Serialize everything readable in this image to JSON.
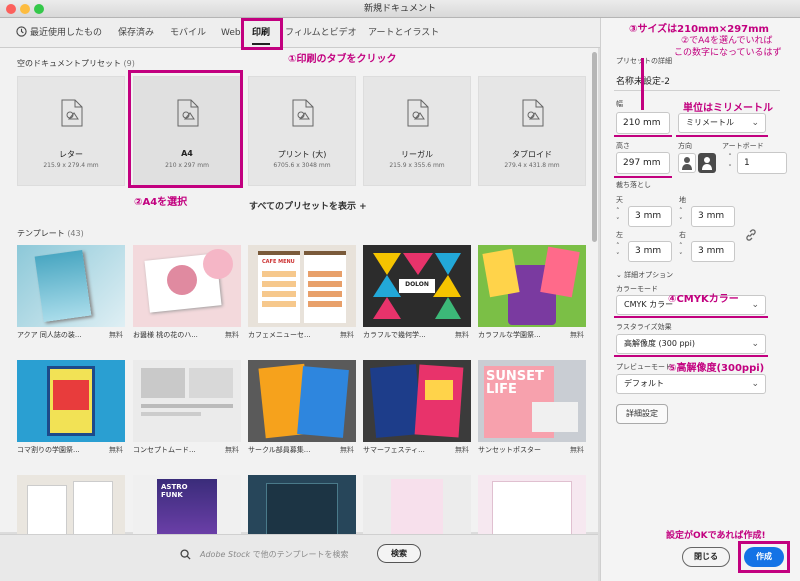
{
  "window": {
    "title": "新規ドキュメント"
  },
  "tabs": [
    {
      "label": "最近使用したもの"
    },
    {
      "label": "保存済み"
    },
    {
      "label": "モバイル"
    },
    {
      "label": "Web"
    },
    {
      "label": "印刷"
    },
    {
      "label": "フィルムとビデオ"
    },
    {
      "label": "アートとイラスト"
    }
  ],
  "presets": {
    "heading": "空のドキュメントプリセット",
    "count": "(9)",
    "show_all": "すべてのプリセットを表示 +",
    "items": [
      {
        "name": "レター",
        "size": "215.9 x 279.4 mm"
      },
      {
        "name": "A4",
        "size": "210 x 297 mm"
      },
      {
        "name": "プリント (大)",
        "size": "6705.6 x 3048 mm"
      },
      {
        "name": "リーガル",
        "size": "215.9 x 355.6 mm"
      },
      {
        "name": "タブロイド",
        "size": "279.4 x 431.8 mm"
      }
    ]
  },
  "templates": {
    "heading": "テンプレート",
    "count": "(43)",
    "free": "無料",
    "items": [
      {
        "name": "アクア 同人誌の装..."
      },
      {
        "name": "お醤様 桃の花のハ..."
      },
      {
        "name": "カフェメニューセ..."
      },
      {
        "name": "カラフルで幾何学..."
      },
      {
        "name": "カラフルな学園祭..."
      },
      {
        "name": "コマ割りの学園祭..."
      },
      {
        "name": "コンセプトムード..."
      },
      {
        "name": "サークル部員募集..."
      },
      {
        "name": "サマーフェスティ..."
      },
      {
        "name": "サンセットポスター"
      }
    ],
    "thumb_text": {
      "menu": "CAFE MENU",
      "dolon": "DOLON",
      "sunset": "SUNSET\nLIFE",
      "astro": "ASTRO\nFUNK"
    }
  },
  "search": {
    "placeholder_brand": "Adobe Stock",
    "placeholder": " で他のテンプレートを検索",
    "button": "検索"
  },
  "details": {
    "heading": "プリセットの詳細",
    "name": "名称未設定-2",
    "width_label": "幅",
    "width_value": "210 mm",
    "unit": "ミリメートル",
    "height_label": "高さ",
    "height_value": "297 mm",
    "orientation_label": "方向",
    "artboard_label": "アートボード",
    "artboard_value": "1",
    "bleed_label": "裁ち落とし",
    "top_label": "天",
    "bottom_label": "地",
    "left_label": "左",
    "right_label": "右",
    "bleed_value": "3 mm",
    "advanced_label": "詳細オプション",
    "color_mode_label": "カラーモード",
    "color_mode": "CMYK カラー",
    "raster_label": "ラスタライズ効果",
    "raster": "高解像度 (300 ppi)",
    "preview_label": "プレビューモード",
    "preview": "デフォルト",
    "advanced_button": "詳細設定",
    "close_button": "閉じる",
    "create_button": "作成"
  },
  "annotations": {
    "a1": "①印刷のタブをクリック",
    "a2": "②A4を選択",
    "a3": "③サイズは210mm×297mm",
    "a3b": "②でA4を選んでいれば",
    "a3c": "この数字になっているはず",
    "a_unit": "単位はミリメートル",
    "a4": "④CMYKカラー",
    "a5": "⑤高解像度(300ppi)",
    "a6": "設定がOKであれば作成!"
  },
  "colors": {
    "accent": "#c2007f",
    "primary": "#1473e6"
  }
}
